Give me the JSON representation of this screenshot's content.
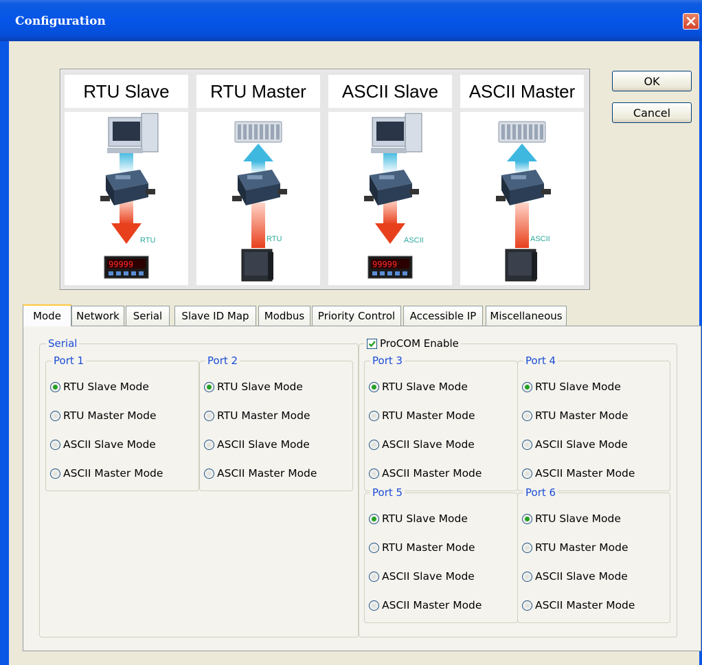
{
  "window": {
    "title": "Configuration"
  },
  "diagram": {
    "panels": [
      {
        "title": "RTU Slave",
        "protocol": "RTU",
        "upper": "pc",
        "lower": "meter",
        "direction": "down"
      },
      {
        "title": "RTU Master",
        "protocol": "RTU",
        "upper": "plc",
        "lower": "panel",
        "direction": "up"
      },
      {
        "title": "ASCII Slave",
        "protocol": "ASCII",
        "upper": "pc",
        "lower": "meter",
        "direction": "down"
      },
      {
        "title": "ASCII Master",
        "protocol": "ASCII",
        "upper": "plc",
        "lower": "panel",
        "direction": "up"
      }
    ]
  },
  "buttons": {
    "ok": "OK",
    "cancel": "Cancel"
  },
  "tabs": [
    "Mode",
    "Network",
    "Serial",
    "Slave ID Map",
    "Modbus",
    "Priority Control",
    "Accessible IP",
    "Miscellaneous"
  ],
  "active_tab": "Mode",
  "serial_group": {
    "label": "Serial"
  },
  "procom": {
    "label": "ProCOM Enable",
    "checked": true
  },
  "mode_options": [
    "RTU Slave Mode",
    "RTU Master Mode",
    "ASCII Slave Mode",
    "ASCII Master Mode"
  ],
  "ports": [
    {
      "label": "Port 1",
      "selected": 0
    },
    {
      "label": "Port 2",
      "selected": 0
    },
    {
      "label": "Port 3",
      "selected": 0
    },
    {
      "label": "Port 4",
      "selected": 0
    },
    {
      "label": "Port 5",
      "selected": 0
    },
    {
      "label": "Port 6",
      "selected": 0
    }
  ],
  "colors": {
    "title_bar": "#0655e8",
    "group_label": "#1a4cd6",
    "radio_dot": "#25a125",
    "tab_highlight": "#ffc83c"
  }
}
